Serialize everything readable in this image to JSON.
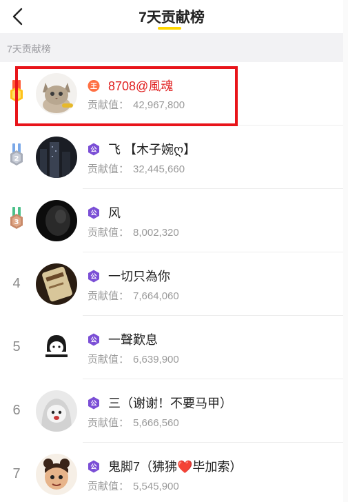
{
  "nav": {
    "title": "7天贡献榜"
  },
  "section": {
    "header": "7天贡献榜"
  },
  "contribution_label": "贡献值：",
  "ranking": [
    {
      "rank": "1",
      "name": "8708@風魂",
      "value": "42,967,800",
      "badge": "crown-badge-red",
      "medal": "gold"
    },
    {
      "rank": "2",
      "name": "飞 【木子婉ღ】",
      "value": "32,445,660",
      "badge": "purple-hexagon-badge",
      "medal": "silver"
    },
    {
      "rank": "3",
      "name": "风",
      "value": "8,002,320",
      "badge": "purple-hexagon-badge",
      "medal": "bronze"
    },
    {
      "rank": "4",
      "name": "一切只為你",
      "value": "7,664,060",
      "badge": "purple-hexagon-badge"
    },
    {
      "rank": "5",
      "name": "一聲歎息",
      "value": "6,639,900",
      "badge": "purple-hexagon-badge"
    },
    {
      "rank": "6",
      "name": "三（谢谢！不要马甲）",
      "value": "5,666,560",
      "badge": "purple-hexagon-badge"
    },
    {
      "rank": "7",
      "name": "鬼脚7（狒狒❤️毕加索）",
      "value": "5,545,900",
      "badge": "purple-hexagon-badge"
    }
  ],
  "colors": {
    "accent_yellow": "#ffd600",
    "highlight_red": "#e8141a",
    "top_name_red": "#e02020",
    "badge_purple": "#7b4fd6"
  }
}
